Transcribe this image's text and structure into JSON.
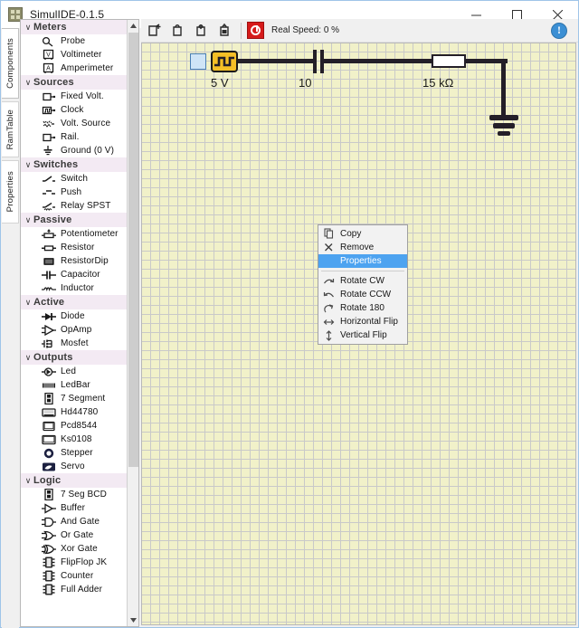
{
  "window": {
    "title": "SimulIDE-0.1.5",
    "icon": "app-icon",
    "minimize": "minimize-icon",
    "maximize": "maximize-icon",
    "close": "close-icon"
  },
  "vtabs": [
    {
      "label": "Components",
      "selected": true
    },
    {
      "label": "RamTable",
      "selected": false
    },
    {
      "label": "Properties",
      "selected": false
    }
  ],
  "toolbar": {
    "buttons": [
      {
        "name": "new-circuit-button",
        "icon": "new-file-icon"
      },
      {
        "name": "open-circuit-button",
        "icon": "open-folder-icon"
      },
      {
        "name": "save-circuit-button",
        "icon": "save-icon"
      },
      {
        "name": "save-as-button",
        "icon": "save-as-icon"
      }
    ],
    "power_button": {
      "name": "power-button",
      "icon": "power-icon"
    },
    "speed_label": "Real Speed: 0 %",
    "info_icon": "info-icon",
    "info_glyph": "!"
  },
  "panel": {
    "sections": [
      {
        "label": "Meters",
        "arrow": "∨",
        "items": [
          {
            "label": "Probe",
            "icon": "probe-icon"
          },
          {
            "label": "Voltimeter",
            "icon": "voltimeter-icon"
          },
          {
            "label": "Amperimeter",
            "icon": "amperimeter-icon"
          }
        ]
      },
      {
        "label": "Sources",
        "arrow": "∨",
        "items": [
          {
            "label": "Fixed Volt.",
            "icon": "fixed-volt-icon"
          },
          {
            "label": "Clock",
            "icon": "clock-icon"
          },
          {
            "label": "Volt. Source",
            "icon": "volt-source-icon"
          },
          {
            "label": "Rail.",
            "icon": "rail-icon"
          },
          {
            "label": "Ground (0 V)",
            "icon": "ground-icon"
          }
        ]
      },
      {
        "label": "Switches",
        "arrow": "∨",
        "items": [
          {
            "label": "Switch",
            "icon": "switch-icon"
          },
          {
            "label": "Push",
            "icon": "push-button-icon"
          },
          {
            "label": "Relay SPST",
            "icon": "relay-icon"
          }
        ]
      },
      {
        "label": "Passive",
        "arrow": "∨",
        "items": [
          {
            "label": "Potentiometer",
            "icon": "potentiometer-icon"
          },
          {
            "label": "Resistor",
            "icon": "resistor-icon"
          },
          {
            "label": "ResistorDip",
            "icon": "resistor-dip-icon"
          },
          {
            "label": "Capacitor",
            "icon": "capacitor-icon"
          },
          {
            "label": "Inductor",
            "icon": "inductor-icon"
          }
        ]
      },
      {
        "label": "Active",
        "arrow": "∨",
        "items": [
          {
            "label": "Diode",
            "icon": "diode-icon"
          },
          {
            "label": "OpAmp",
            "icon": "opamp-icon"
          },
          {
            "label": "Mosfet",
            "icon": "mosfet-icon"
          }
        ]
      },
      {
        "label": "Outputs",
        "arrow": "∨",
        "items": [
          {
            "label": "Led",
            "icon": "led-icon"
          },
          {
            "label": "LedBar",
            "icon": "ledbar-icon"
          },
          {
            "label": "7 Segment",
            "icon": "seven-segment-icon"
          },
          {
            "label": "Hd44780",
            "icon": "hd44780-icon"
          },
          {
            "label": "Pcd8544",
            "icon": "pcd8544-icon"
          },
          {
            "label": "Ks0108",
            "icon": "ks0108-icon"
          },
          {
            "label": "Stepper",
            "icon": "stepper-icon"
          },
          {
            "label": "Servo",
            "icon": "servo-icon"
          }
        ]
      },
      {
        "label": "Logic",
        "arrow": "∨",
        "items": [
          {
            "label": "7 Seg BCD",
            "icon": "seven-seg-bcd-icon"
          },
          {
            "label": "Buffer",
            "icon": "buffer-gate-icon"
          },
          {
            "label": "And Gate",
            "icon": "and-gate-icon"
          },
          {
            "label": "Or Gate",
            "icon": "or-gate-icon"
          },
          {
            "label": "Xor Gate",
            "icon": "xor-gate-icon"
          },
          {
            "label": "FlipFlop JK",
            "icon": "flipflop-jk-icon"
          },
          {
            "label": "Counter",
            "icon": "counter-icon"
          },
          {
            "label": "Full Adder",
            "icon": "full-adder-icon"
          }
        ]
      }
    ],
    "scrollbar": {
      "up_arrow": "∧",
      "down_arrow": "∨"
    }
  },
  "circuit": {
    "labels": [
      {
        "text": "5 V",
        "name": "clock-value-label"
      },
      {
        "text": "10",
        "name": "capacitor-value-label"
      },
      {
        "text": "15 kΩ",
        "name": "resistor-value-label"
      }
    ]
  },
  "context_menu": {
    "items": [
      {
        "label": "Copy",
        "icon": "copy-icon",
        "highlighted": false,
        "separator_after": false
      },
      {
        "label": "Remove",
        "icon": "remove-icon",
        "highlighted": false,
        "separator_after": false
      },
      {
        "label": "Properties",
        "icon": "properties-icon",
        "highlighted": true,
        "separator_after": true
      },
      {
        "label": "Rotate CW",
        "icon": "rotate-cw-icon",
        "highlighted": false,
        "separator_after": false
      },
      {
        "label": "Rotate CCW",
        "icon": "rotate-ccw-icon",
        "highlighted": false,
        "separator_after": false
      },
      {
        "label": "Rotate 180",
        "icon": "rotate-180-icon",
        "highlighted": false,
        "separator_after": false
      },
      {
        "label": "Horizontal Flip",
        "icon": "horizontal-flip-icon",
        "highlighted": false,
        "separator_after": false
      },
      {
        "label": "Vertical Flip",
        "icon": "vertical-flip-icon",
        "highlighted": false,
        "separator_after": false
      }
    ]
  },
  "colors": {
    "grid_bg": "#f1f1c9",
    "grid_line": "#c9c9c9",
    "clock_body": "#f5bf26",
    "wire": "#241f28",
    "menu_highlight": "#4da3f0",
    "power_red": "#d61b1b",
    "section_header": "#f3eaf3"
  }
}
